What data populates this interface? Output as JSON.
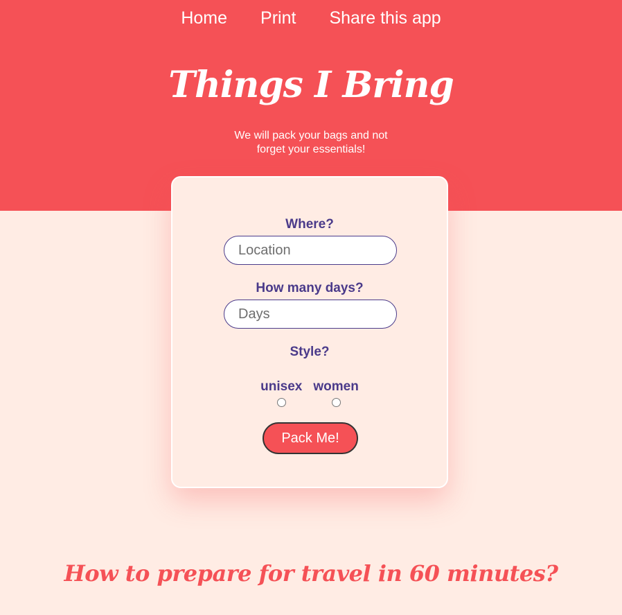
{
  "nav": {
    "items": [
      "Home",
      "Print",
      "Share this app"
    ]
  },
  "hero": {
    "title": "Things I Bring",
    "tagline": "We will pack your bags and not forget your essentials!"
  },
  "form": {
    "location_label": "Where?",
    "location_placeholder": "Location",
    "days_label": "How many days?",
    "days_placeholder": "Days",
    "style_label": "Style?",
    "style_options": [
      "unisex",
      "women"
    ],
    "submit_label": "Pack Me!"
  },
  "section": {
    "heading": "How to prepare for travel in 60 minutes?"
  },
  "colors": {
    "brand": "#f55156",
    "background": "#ffece4",
    "label": "#4a3a8a"
  }
}
